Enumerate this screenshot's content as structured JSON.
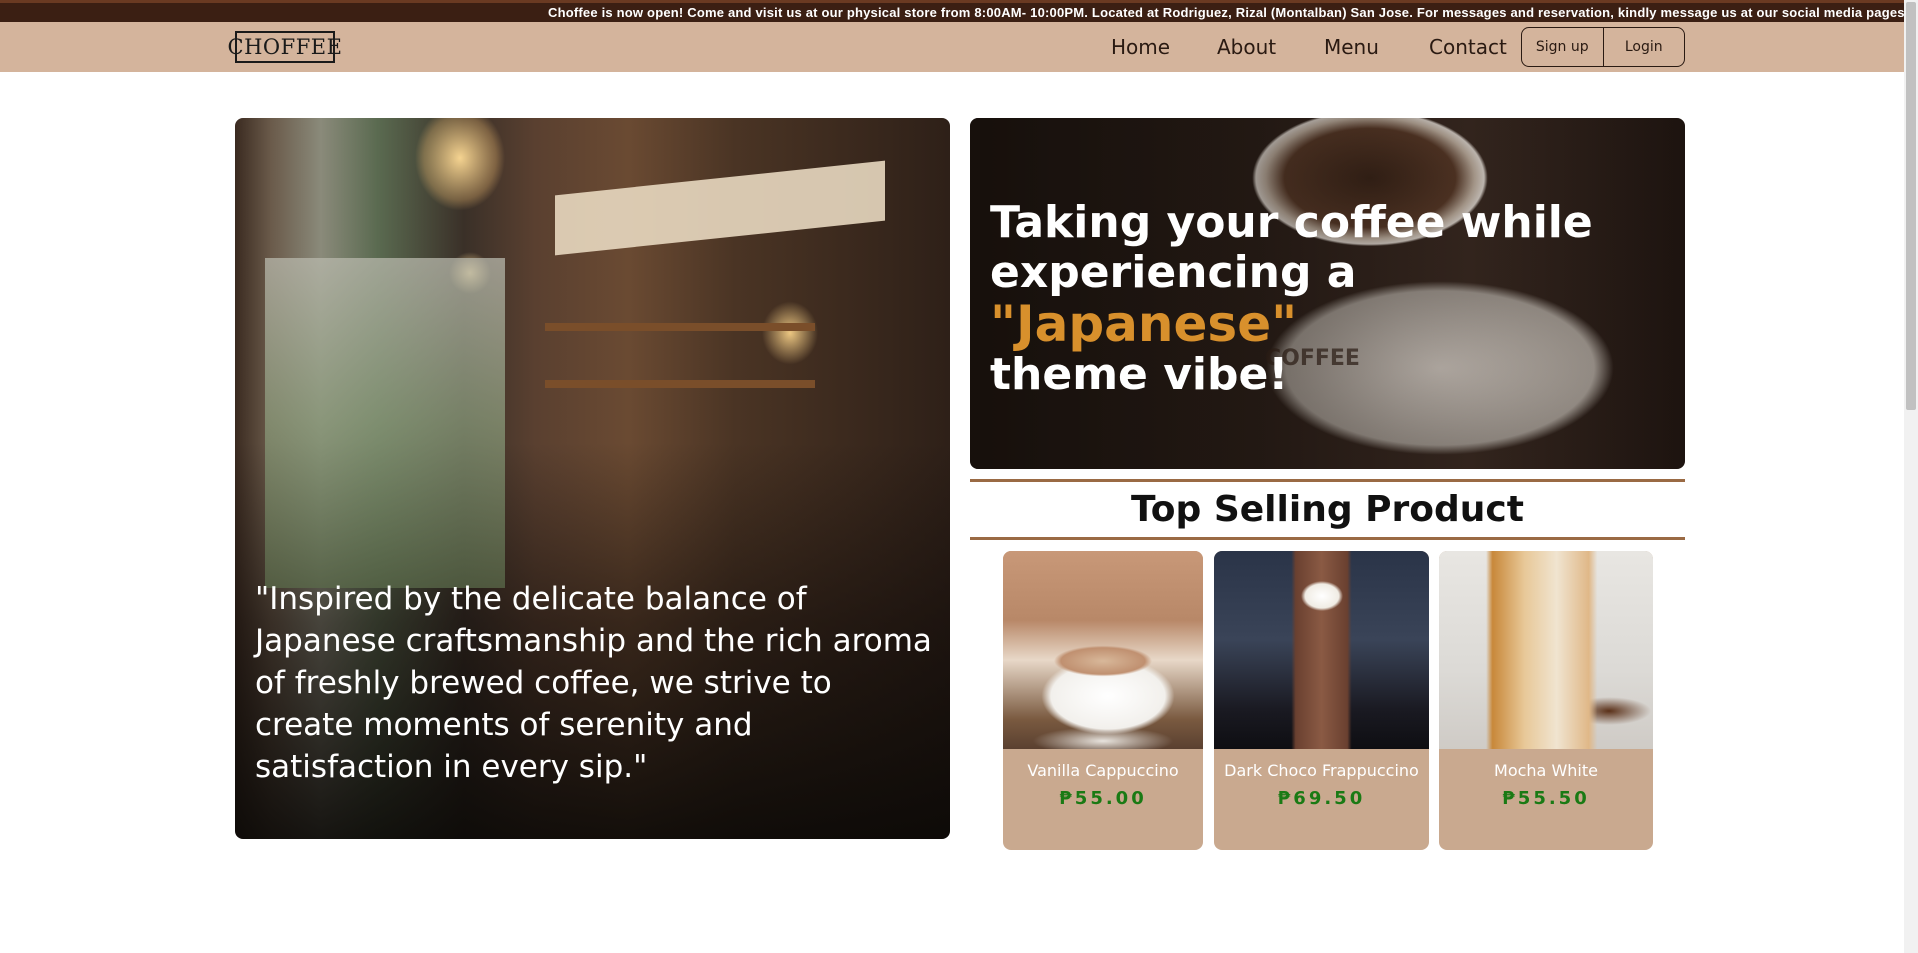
{
  "announcement": "Choffee is now open! Come and visit us at our physical store from 8:00AM- 10:00PM. Located at Rodriguez, Rizal (Montalban) San Jose. For messages and reservation, kindly message us at our social media pages.",
  "nav": {
    "logo": "CHOFFEE",
    "links": [
      "Home",
      "About",
      "Menu",
      "Contact"
    ],
    "signup": "Sign up",
    "login": "Login"
  },
  "hero_left": {
    "quote": "\"Inspired by the delicate balance of Japanese craftsmanship and the rich aroma of freshly brewed coffee, we strive to create moments of serenity and satisfaction in every sip.\""
  },
  "hero_right": {
    "line1": "Taking your coffee while experiencing a",
    "highlight": "\"Japanese\"",
    "line2": "theme vibe!",
    "cup_label": "COFFEE"
  },
  "top_selling": {
    "heading": "Top Selling Product",
    "products": [
      {
        "name": "Vanilla Cappuccino",
        "price": "₱55.00"
      },
      {
        "name": "Dark Choco Frappuccino",
        "price": "₱69.50"
      },
      {
        "name": "Mocha White",
        "price": "₱55.50"
      }
    ]
  },
  "colors": {
    "nav_bg": "#d4b49c",
    "announce_bg": "#3b1f13",
    "accent": "#d8902c",
    "price": "#1a7a14",
    "card_bg": "#c9a98f",
    "divider": "#9a6a44"
  }
}
